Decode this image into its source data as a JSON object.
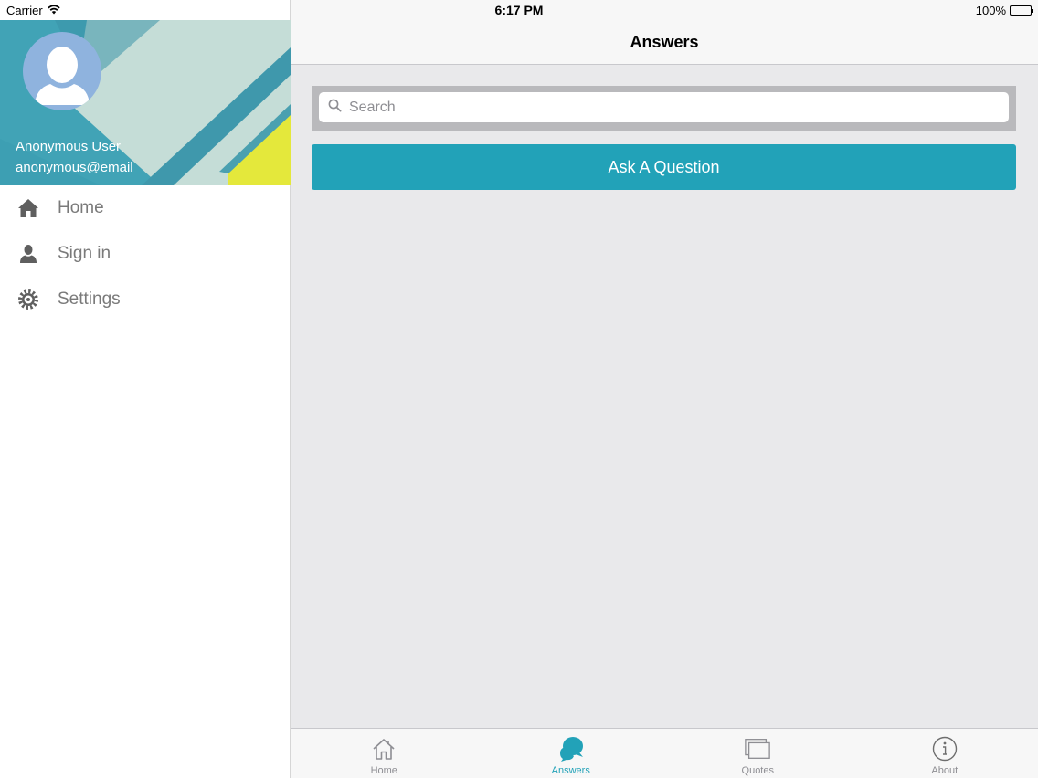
{
  "status_bar": {
    "carrier": "Carrier",
    "time": "6:17 PM",
    "battery": "100%"
  },
  "sidebar": {
    "user_name": "Anonymous User",
    "user_email": "anonymous@email",
    "items": [
      {
        "label": "Home",
        "icon": "home-icon"
      },
      {
        "label": "Sign in",
        "icon": "person-icon"
      },
      {
        "label": "Settings",
        "icon": "gear-icon"
      }
    ]
  },
  "navbar": {
    "title": "Answers"
  },
  "search": {
    "placeholder": "Search",
    "value": ""
  },
  "ask_button": {
    "label": "Ask A Question"
  },
  "tabbar": {
    "active_index": 1,
    "tabs": [
      {
        "label": "Home",
        "icon": "home-outline-icon"
      },
      {
        "label": "Answers",
        "icon": "chat-bubbles-icon"
      },
      {
        "label": "Quotes",
        "icon": "stacked-windows-icon"
      },
      {
        "label": "About",
        "icon": "info-circle-icon"
      }
    ]
  },
  "colors": {
    "accent": "#22a2b8",
    "avatar_bg": "#8fb3de",
    "header_teal": "#41a3b6",
    "header_yellow": "#e4e83b",
    "menu_text": "#7a7a7a",
    "main_bg": "#e9e9eb"
  }
}
